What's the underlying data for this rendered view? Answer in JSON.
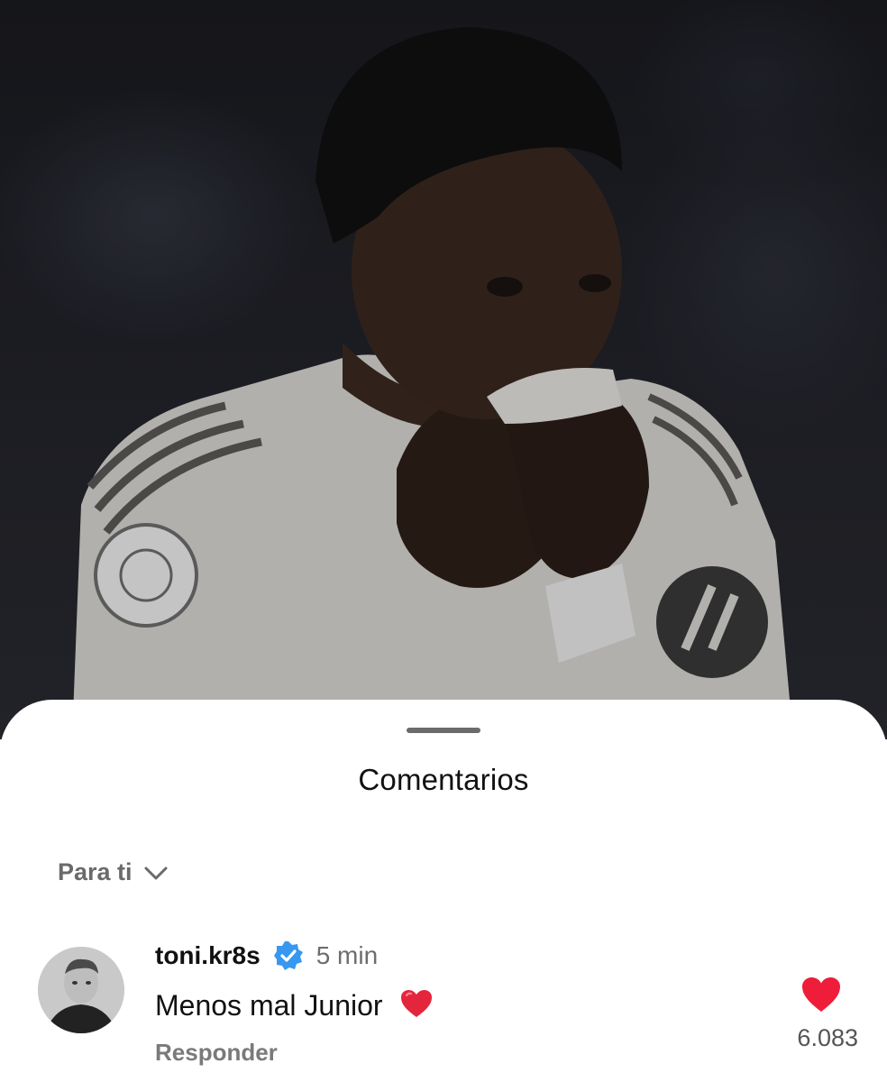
{
  "photo": {
    "alt_icon": "post-photo"
  },
  "sheet": {
    "title": "Comentarios",
    "sort_label": "Para ti"
  },
  "comment": {
    "username": "toni.kr8s",
    "verified": true,
    "time": "5 min",
    "text": "Menos mal Junior",
    "emoji": "red-heart-emoji",
    "reply_label": "Responder",
    "like_count": "6.083",
    "like_color": "#ee1d3a"
  },
  "colors": {
    "verified": "#3897f0",
    "like": "#ee1d3a"
  }
}
